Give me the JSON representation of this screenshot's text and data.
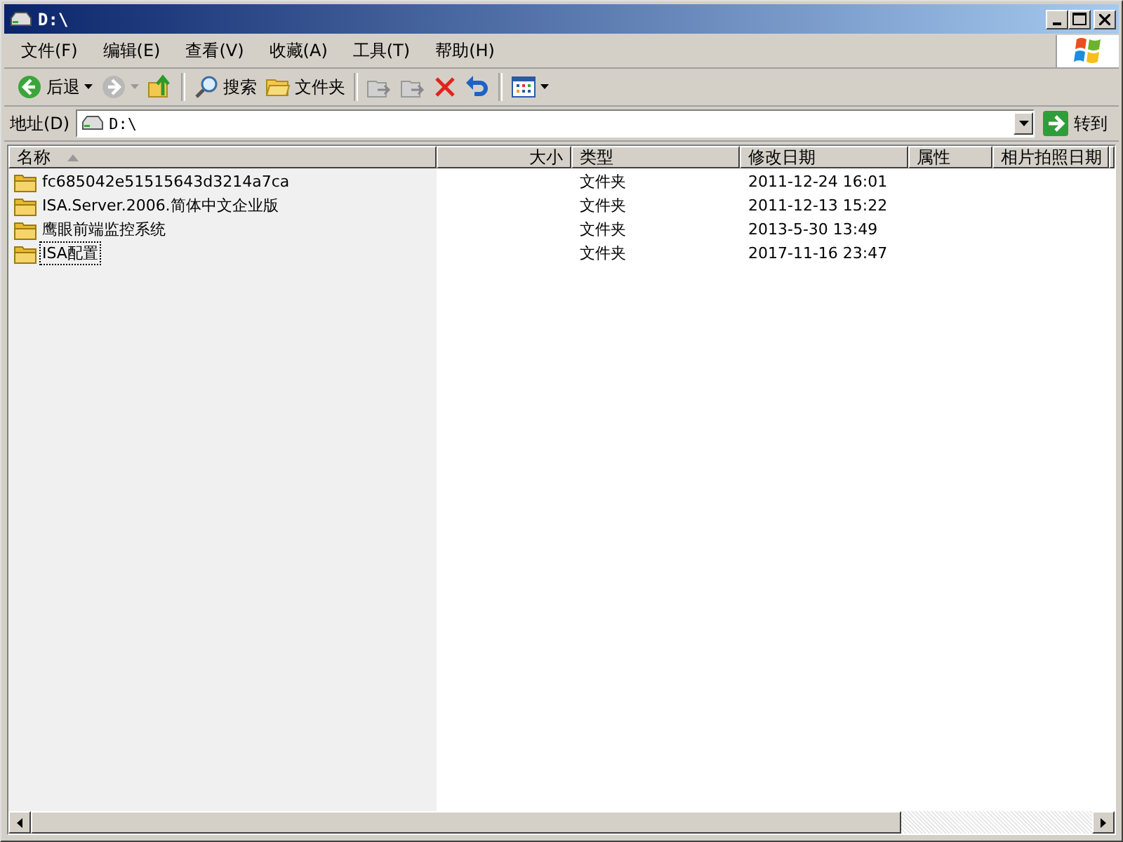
{
  "window": {
    "title": "D:\\"
  },
  "menu": [
    {
      "label": "文件(F)"
    },
    {
      "label": "编辑(E)"
    },
    {
      "label": "查看(V)"
    },
    {
      "label": "收藏(A)"
    },
    {
      "label": "工具(T)"
    },
    {
      "label": "帮助(H)"
    }
  ],
  "toolbar": [
    {
      "kind": "back",
      "label": "后退",
      "disabled": false,
      "dropdown": true
    },
    {
      "kind": "forward",
      "disabled": true,
      "dropdown": true
    },
    {
      "kind": "up",
      "disabled": false
    },
    {
      "kind": "separator"
    },
    {
      "kind": "search",
      "label": "搜索",
      "disabled": false
    },
    {
      "kind": "folders",
      "label": "文件夹",
      "disabled": false
    },
    {
      "kind": "separator"
    },
    {
      "kind": "move",
      "disabled": true
    },
    {
      "kind": "copy",
      "disabled": true
    },
    {
      "kind": "delete",
      "disabled": false
    },
    {
      "kind": "undo",
      "disabled": false
    },
    {
      "kind": "separator"
    },
    {
      "kind": "views",
      "disabled": false,
      "dropdown": true
    }
  ],
  "address": {
    "label": "地址(D)",
    "value": "D:\\",
    "go": "转到"
  },
  "columns": [
    {
      "label": "名称",
      "sorted": true
    },
    {
      "label": "大小",
      "sorted": false
    },
    {
      "label": "类型",
      "sorted": false
    },
    {
      "label": "修改日期",
      "sorted": false
    },
    {
      "label": "属性",
      "sorted": false
    },
    {
      "label": "相片拍照日期",
      "sorted": false
    }
  ],
  "rows": [
    {
      "name": "fc685042e51515643d3214a7ca",
      "type": "文件夹",
      "modified": "2011-12-24 16:01",
      "focused": false
    },
    {
      "name": "ISA.Server.2006.简体中文企业版",
      "type": "文件夹",
      "modified": "2011-12-13 15:22",
      "focused": false
    },
    {
      "name": "鹰眼前端监控系统",
      "type": "文件夹",
      "modified": "2013-5-30 13:49",
      "focused": false
    },
    {
      "name": "ISA配置",
      "type": "文件夹",
      "modified": "2017-11-16 23:47",
      "focused": true
    }
  ]
}
